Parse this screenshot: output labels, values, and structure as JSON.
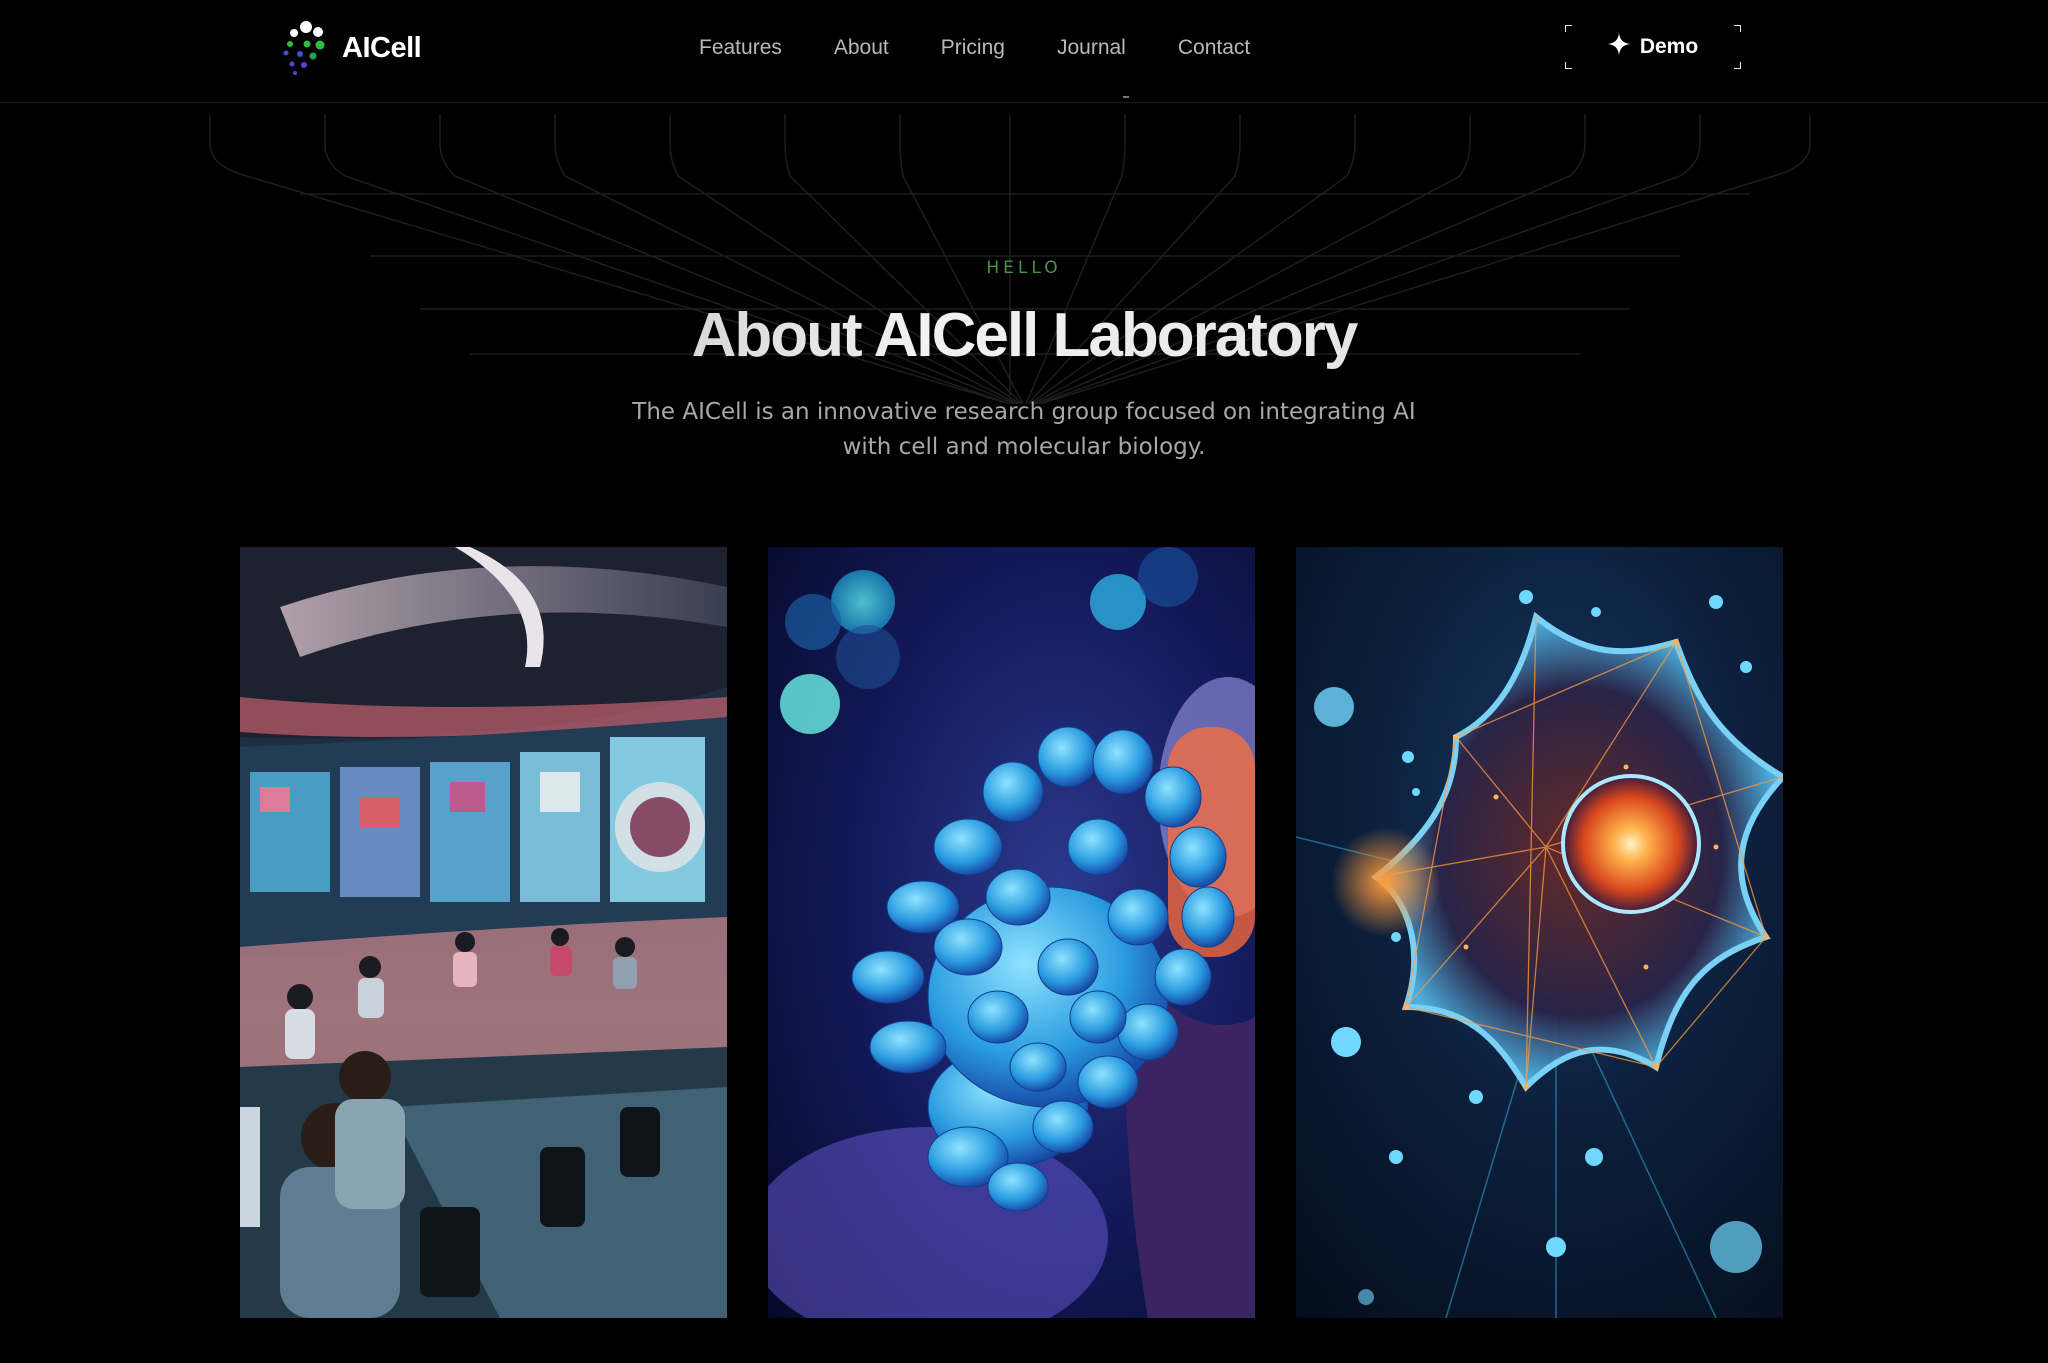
{
  "brand": {
    "name": "AICell",
    "logo_icon": "dots-cluster-icon"
  },
  "nav": {
    "links": [
      {
        "label": "Features"
      },
      {
        "label": "About"
      },
      {
        "label": "Pricing"
      },
      {
        "label": "Journal"
      },
      {
        "label": "Contact"
      }
    ],
    "demo_label": "Demo",
    "demo_icon": "sparkle-icon"
  },
  "hero": {
    "eyebrow": "HELLO",
    "title": "About AICell Laboratory",
    "subtitle": "The AICell is an innovative research group focused on integrating AI with cell and molecular biology."
  },
  "gallery": [
    {
      "name": "research-control-room-image"
    },
    {
      "name": "blue-coral-cells-image"
    },
    {
      "name": "glowing-neuron-cell-image"
    }
  ],
  "colors": {
    "background": "#000000",
    "accent_green": "#4f8f4a",
    "text_muted": "#a8a8a8"
  }
}
